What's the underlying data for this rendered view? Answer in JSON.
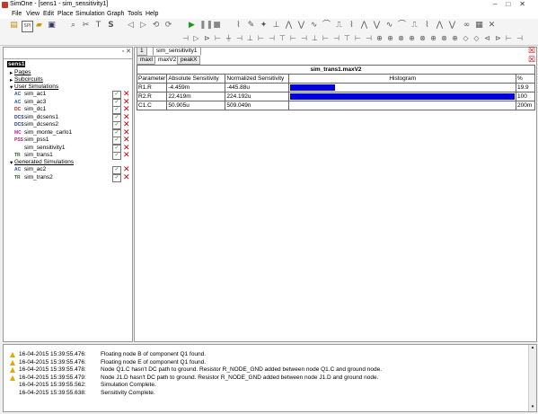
{
  "window": {
    "title": "SimOne - [sens1 - sim_sensitivity1]"
  },
  "menu": [
    "File",
    "View",
    "Edit",
    "Place",
    "Simulation",
    "Graph",
    "Tools",
    "Help"
  ],
  "tree": {
    "root": "sens1",
    "pages": "Pages",
    "subcircuits": "Subcircuits",
    "user_simulations": "User Simulations",
    "user_items": [
      {
        "prefix": "AC",
        "label": "sim_ac1",
        "color": "#2255aa"
      },
      {
        "prefix": "AC",
        "label": "sim_ac3",
        "color": "#2255aa"
      },
      {
        "prefix": "DC",
        "label": "sim_dc1",
        "color": "#aa2222"
      },
      {
        "prefix": "DCS",
        "label": "sim_dcsens1",
        "color": "#223377"
      },
      {
        "prefix": "DCS",
        "label": "sim_dcsens2",
        "color": "#223377"
      },
      {
        "prefix": "MC",
        "label": "sim_monte_carlo1",
        "color": "#aa22aa"
      },
      {
        "prefix": "PSS",
        "label": "sim_pss1",
        "color": "#aa2277"
      },
      {
        "prefix": "",
        "label": "sim_sensitivity1",
        "color": "#000000"
      },
      {
        "prefix": "TR",
        "label": "sim_trans1",
        "color": "#226622"
      }
    ],
    "generated_simulations": "Generated Simulations",
    "generated_items": [
      {
        "prefix": "AC",
        "label": "sim_ac2",
        "color": "#2255aa"
      },
      {
        "prefix": "TR",
        "label": "sim_trans2",
        "color": "#226622"
      }
    ]
  },
  "document": {
    "page_tab": "1",
    "doc_tab": "sim_sensitivity1",
    "sub_tabs": [
      "maxI",
      "maxV2",
      "peakX"
    ],
    "table_caption": "sim_trans1.maxV2",
    "columns": [
      "Parameter",
      "Absolute Sensitivity",
      "Normalized Sensitivity",
      "Histogram",
      "%"
    ],
    "rows": [
      {
        "param": "R1.R",
        "abs": "-4.459m",
        "norm": "-445.88u",
        "bar": 0.199,
        "pct": "19.9"
      },
      {
        "param": "R2.R",
        "abs": "22.419m",
        "norm": "224.192u",
        "bar": 1.0,
        "pct": "100"
      },
      {
        "param": "C1.C",
        "abs": "50.905u",
        "norm": "509.049n",
        "bar": 0.0,
        "pct": "200m"
      }
    ]
  },
  "log": [
    {
      "warn": true,
      "time": "16-04-2015 15:39:55.476:",
      "msg": "Floating node B of component Q1 found."
    },
    {
      "warn": true,
      "time": "16-04-2015 15:39:55.476:",
      "msg": "Floating node E of component Q1 found."
    },
    {
      "warn": true,
      "time": "16-04-2015 15:39:55.478:",
      "msg": "Node Q1.C hasn't DC path to ground. Resistor R_NODE_GND added between node Q1.C and ground node."
    },
    {
      "warn": true,
      "time": "16-04-2015 15:39:55.479:",
      "msg": "Node J1.D hasn't DC path to ground. Resistor R_NODE_GND added between node J1.D and ground node."
    },
    {
      "warn": false,
      "time": "16-04-2015 15:39:55.562:",
      "msg": "Simulation Complete."
    },
    {
      "warn": false,
      "time": "16-04-2015 15:39:55.638:",
      "msg": "Sensitivity Complete."
    }
  ]
}
